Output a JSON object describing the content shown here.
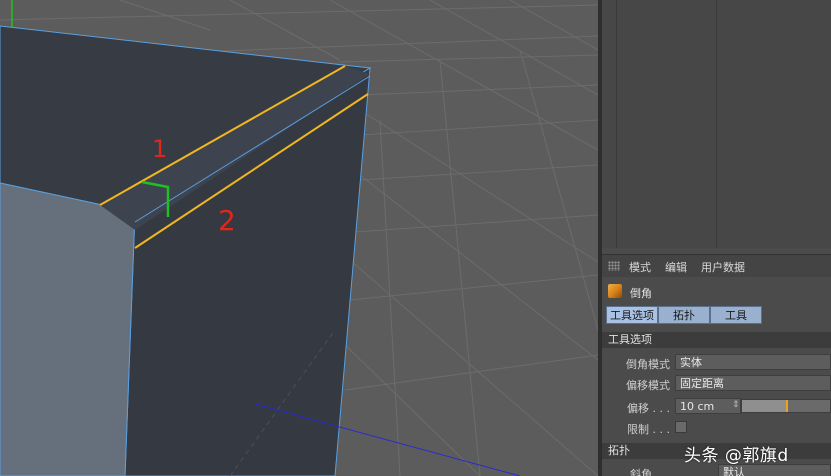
{
  "annotations": {
    "label_1": "1",
    "label_2": "2"
  },
  "colors": {
    "selected_edge": "#f2b720",
    "mesh_edge": "#5aa0e0",
    "annotation": "#e2261a",
    "axis_y": "#21c021",
    "axis_x": "#2a2ad0"
  },
  "attribute_manager": {
    "menu": [
      "模式",
      "编辑",
      "用户数据"
    ],
    "tool_icon": "bevel-tool-icon",
    "tool_name": "倒角",
    "tabs": [
      "工具选项",
      "拓扑",
      "工具"
    ],
    "active_tab": "工具选项",
    "tool_options": {
      "header": "工具选项",
      "bevel_mode": {
        "label": "倒角模式",
        "value": "实体"
      },
      "offset_mode": {
        "label": "偏移模式",
        "value": "固定距离"
      },
      "offset": {
        "label": "偏移 . . .",
        "value": "10 cm",
        "slider_fraction": 0.5
      },
      "limit": {
        "label": "限制 . . .",
        "checked": false
      }
    },
    "topology": {
      "header": "拓扑",
      "miter": {
        "label": "斜角",
        "value": "默认"
      }
    }
  },
  "watermark": "头条 @郭旗d"
}
